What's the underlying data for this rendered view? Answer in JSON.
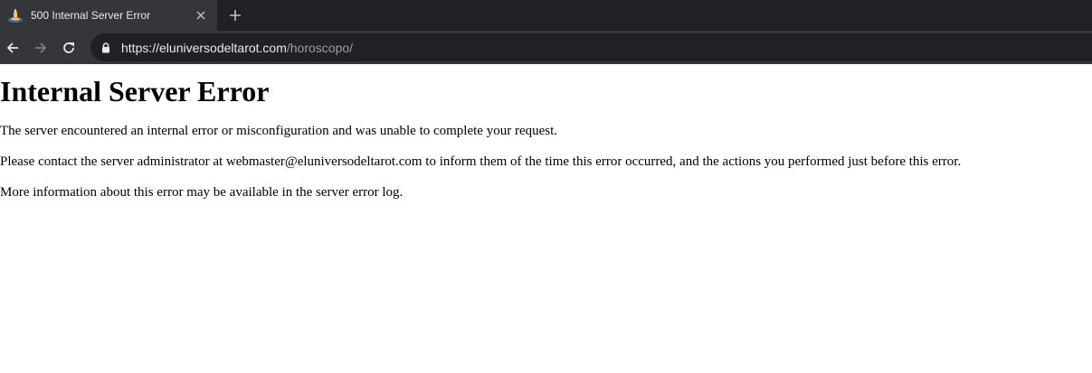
{
  "browser": {
    "tab_title": "500 Internal Server Error",
    "url_host": "https://eluniversodeltarot.com",
    "url_path": "/horoscopo/",
    "colors": {
      "tabstrip": "#202124",
      "active_tab": "#35363a",
      "omnibox": "#202124",
      "text": "#e8eaed",
      "muted": "#9aa0a6"
    }
  },
  "page": {
    "heading": "Internal Server Error",
    "paragraphs": [
      "The server encountered an internal error or misconfiguration and was unable to complete your request.",
      "Please contact the server administrator at webmaster@eluniversodeltarot.com to inform them of the time this error occurred, and the actions you performed just before this error.",
      "More information about this error may be available in the server error log."
    ]
  },
  "icons": {
    "favicon": "tarot-favicon-icon",
    "close": "close-icon",
    "new_tab": "plus-icon",
    "back": "back-arrow-icon",
    "forward": "forward-arrow-icon",
    "reload": "reload-icon",
    "lock": "lock-icon"
  }
}
